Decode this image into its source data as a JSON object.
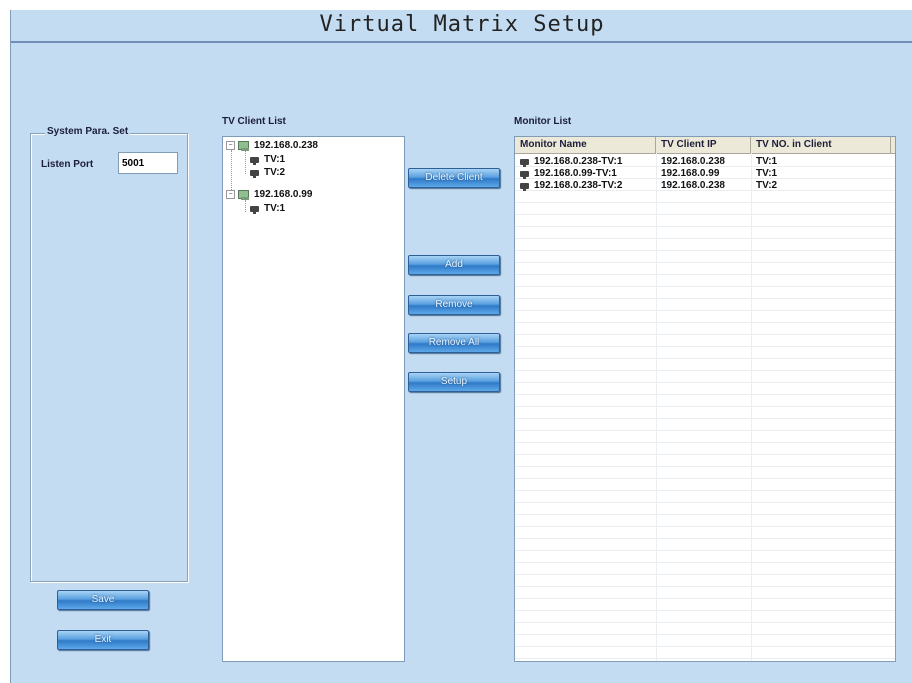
{
  "window": {
    "title": "Virtual Matrix Setup"
  },
  "system": {
    "legend": "System Para. Set",
    "listen_port_label": "Listen Port",
    "listen_port_value": "5001"
  },
  "tree": {
    "label": "TV Client List",
    "clients": [
      {
        "ip": "192.168.0.238",
        "tvs": [
          "TV:1",
          "TV:2"
        ]
      },
      {
        "ip": "192.168.0.99",
        "tvs": [
          "TV:1"
        ]
      }
    ]
  },
  "buttons": {
    "delete_client": "Delete Client",
    "add": "Add",
    "remove": "Remove",
    "remove_all": "Remove All",
    "setup": "Setup",
    "save": "Save",
    "exit": "Exit"
  },
  "monitors": {
    "label": "Monitor List",
    "columns": [
      "Monitor Name",
      "TV Client IP",
      "TV NO. in Client"
    ],
    "rows": [
      [
        "192.168.0.238-TV:1",
        "192.168.0.238",
        "TV:1"
      ],
      [
        "192.168.0.99-TV:1",
        "192.168.0.99",
        "TV:1"
      ],
      [
        "192.168.0.238-TV:2",
        "192.168.0.238",
        "TV:2"
      ]
    ]
  },
  "icons": {
    "tree_client": "computer-icon",
    "tree_tv": "monitor-icon",
    "row": "monitor-icon",
    "expand": "minus-expander-icon"
  }
}
